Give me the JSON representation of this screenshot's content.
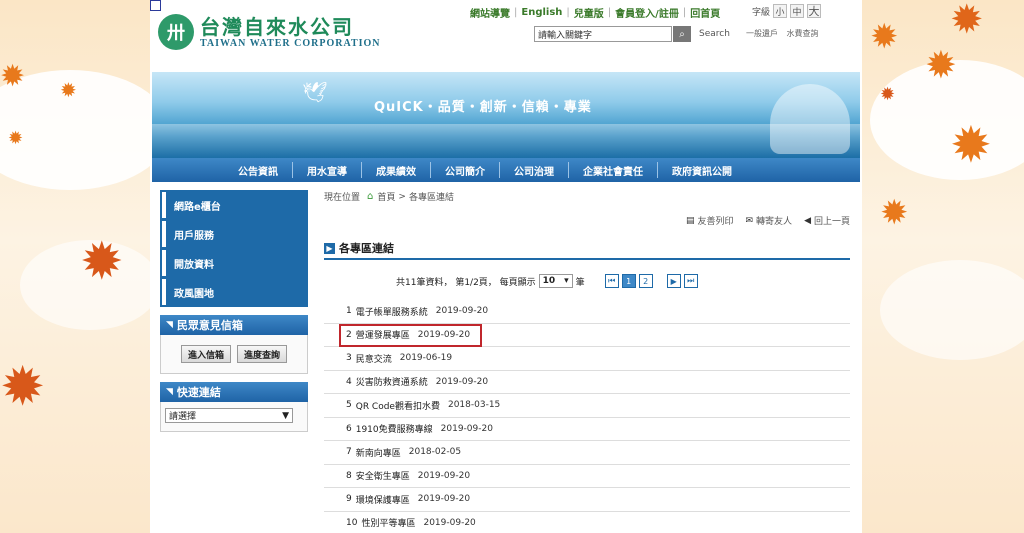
{
  "header": {
    "logo_cn": "台灣自來水公司",
    "logo_en": "TAIWAN WATER CORPORATION",
    "top_links": [
      "網站導覽",
      "English",
      "兒童版",
      "會員登入/註冊",
      "回首頁"
    ],
    "font_size_label": "字級",
    "font_sizes": [
      "小",
      "中",
      "大"
    ],
    "search_placeholder": "請輸入關鍵字",
    "search_label": "Search",
    "sub_links": [
      "一般遺戶",
      "水費查詢"
    ]
  },
  "banner": {
    "slogan": "QuICK・品質・創新・信賴・專業"
  },
  "nav": {
    "items": [
      "公告資訊",
      "用水宣導",
      "成果績效",
      "公司簡介",
      "公司治理",
      "企業社會責任",
      "政府資訊公開"
    ]
  },
  "sidebar": {
    "menu": [
      "網路e櫃台",
      "用戶服務",
      "開放資料",
      "政風園地"
    ],
    "mailbox_title": "民眾意見信箱",
    "mailbox_buttons": [
      "進入信箱",
      "進度查詢"
    ],
    "quicklinks_title": "快速連結",
    "quicklinks_select": "請選擇"
  },
  "main": {
    "breadcrumb_label": "現在位置",
    "breadcrumb_home": "首頁",
    "breadcrumb_sep": ">",
    "breadcrumb_current": "各專區連結",
    "tools": [
      "友善列印",
      "轉寄友人",
      "回上一頁"
    ],
    "section_title": "各專區連結",
    "pager": {
      "summary": "共11筆資料， 第1/2頁， 每頁顯示",
      "per_page": "10",
      "unit": "筆",
      "pages": [
        "1",
        "2"
      ],
      "current_page": "1"
    },
    "items": [
      {
        "num": "1",
        "title": "電子帳單服務系統",
        "date": "2019-09-20"
      },
      {
        "num": "2",
        "title": "營運發展專區",
        "date": "2019-09-20"
      },
      {
        "num": "3",
        "title": "民意交流",
        "date": "2019-06-19"
      },
      {
        "num": "4",
        "title": "災害防救資通系統",
        "date": "2019-09-20"
      },
      {
        "num": "5",
        "title": "QR Code觀看扣水費",
        "date": "2018-03-15"
      },
      {
        "num": "6",
        "title": "1910免費服務專線",
        "date": "2019-09-20"
      },
      {
        "num": "7",
        "title": "新南向專區",
        "date": "2018-02-05"
      },
      {
        "num": "8",
        "title": "安全衛生專區",
        "date": "2019-09-20"
      },
      {
        "num": "9",
        "title": "環境保護專區",
        "date": "2019-09-20"
      },
      {
        "num": "10",
        "title": "性別平等專區",
        "date": "2019-09-20"
      }
    ]
  }
}
